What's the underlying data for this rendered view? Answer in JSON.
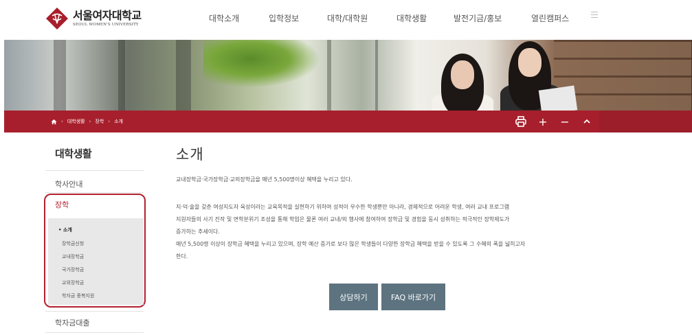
{
  "header": {
    "logo_name_kr": "서울여자대학교",
    "logo_name_en": "SEOUL WOMEN'S UNIVERSITY",
    "brand_color": "#a71f2c",
    "nav": [
      "대학소개",
      "입학정보",
      "대학/대학원",
      "대학생활",
      "발전기금/홍보",
      "열린캠퍼스"
    ]
  },
  "breadcrumb": {
    "home_icon": "home-icon",
    "items": [
      "대학생활",
      "장학",
      "소개"
    ]
  },
  "tools": {
    "print_icon": "print-icon",
    "zoom_in": "+",
    "zoom_out": "−",
    "top": "⌃"
  },
  "sidebar": {
    "title": "대학생활",
    "items": [
      "학사안내",
      "장학",
      "학자금대출"
    ],
    "active": "장학",
    "sub_items": [
      "소개",
      "장학금신청",
      "교내장학금",
      "국가장학금",
      "교외장학금",
      "학자금 중복지원"
    ],
    "active_sub": "소개"
  },
  "content": {
    "title": "소개",
    "intro": "교내장학금·국가장학금·교외장학금을 매년 5,500명이상 혜택을 누리고 있다.",
    "paragraph_lines": [
      "지·덕·술을 갖춘 여성지도자 육성이라는 교육목적을 실현하기 위하여 성적이 우수한 학생뿐만 아니라, 경제적으로 어려운 학생, 여러 교내 프로그램",
      "지원자들의 사기 진작 및 면학분위기 조성을 통해 학업은 물론 여러 교내/외 행사에 참여하여 장학금 및 경험을 동시 성취하는 적극적인 장학제도가",
      "증가하는 추세이다.",
      "매년 5,500명 이상이 장학금 혜택을 누리고 있으며, 장학 예산 증가로 보다 많은 학생들이 다양한 장학금 혜택을 받을 수 있도록 그 수혜의 폭을 넓히고자",
      "한다."
    ],
    "buttons": [
      "상담하기",
      "FAQ 바로가기"
    ]
  }
}
